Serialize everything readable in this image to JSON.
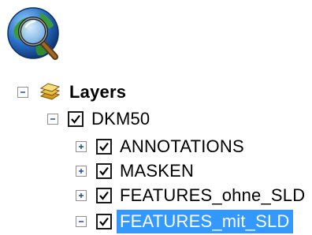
{
  "toc": {
    "root": {
      "label": "Layers",
      "expanded": true
    },
    "group": {
      "label": "DKM50",
      "checked": true,
      "expanded": true
    },
    "layers": [
      {
        "label": "ANNOTATIONS",
        "checked": true,
        "expander": "plus",
        "selected": false
      },
      {
        "label": "MASKEN",
        "checked": true,
        "expander": "plus",
        "selected": false
      },
      {
        "label": "FEATURES_ohne_SLD",
        "checked": true,
        "expander": "plus",
        "selected": false
      },
      {
        "label": "FEATURES_mit_SLD",
        "checked": true,
        "expander": "minus",
        "selected": true
      }
    ]
  },
  "colors": {
    "selection": "#3399ff",
    "globe_ocean": "#2a6fc9",
    "globe_land": "#3c9a3c",
    "layers_icon": "#e8c14a"
  },
  "icons": {
    "app": "globe-magnifier-icon",
    "layers": "layers-stack-icon"
  }
}
